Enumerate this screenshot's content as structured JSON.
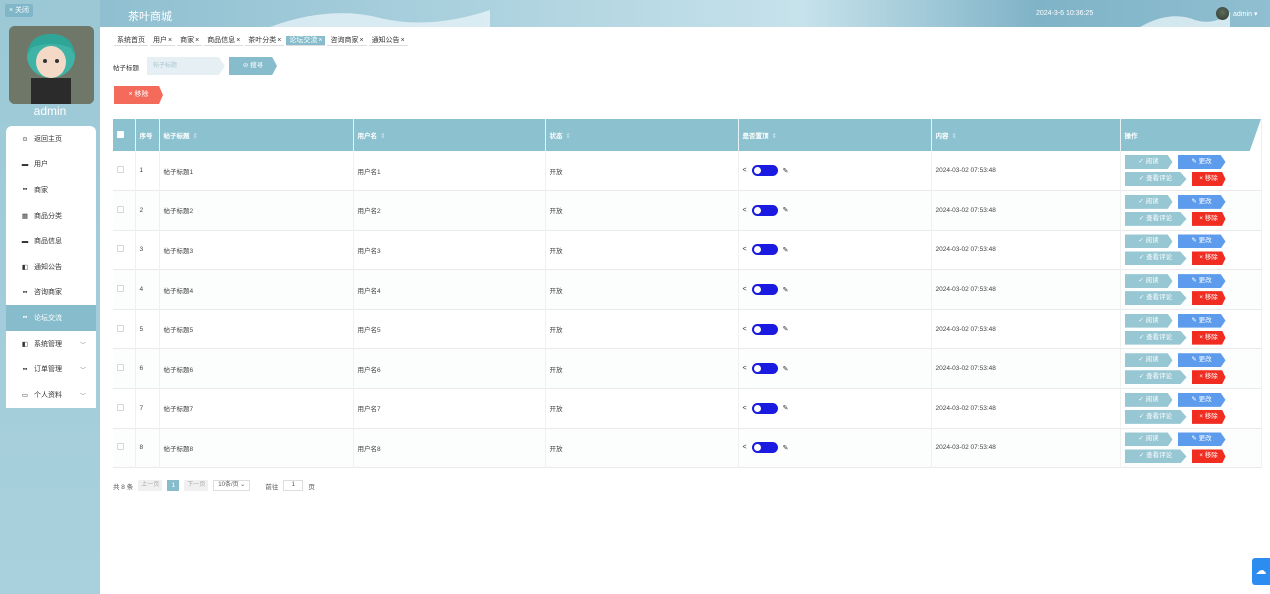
{
  "sidebar": {
    "close_label": "× 关闭",
    "username": "admin",
    "items": [
      {
        "label": "返回主页",
        "icon": "⊙"
      },
      {
        "label": "用户",
        "icon": "▬"
      },
      {
        "label": "商家",
        "icon": "▪▪"
      },
      {
        "label": "商品分类",
        "icon": "▦"
      },
      {
        "label": "商品信息",
        "icon": "▬"
      },
      {
        "label": "通知公告",
        "icon": "◧"
      },
      {
        "label": "咨询商家",
        "icon": "▪▪"
      },
      {
        "label": "论坛交流",
        "icon": "▪▪"
      },
      {
        "label": "系统管理",
        "icon": "◧",
        "arrow": "﹀"
      },
      {
        "label": "订单管理",
        "icon": "▪▪",
        "arrow": "﹀"
      },
      {
        "label": "个人资料",
        "icon": "▭",
        "arrow": "﹀"
      }
    ]
  },
  "header": {
    "title": "茶叶商城",
    "datetime": "2024-3-6 10:36:25",
    "user": "admin ▾"
  },
  "tags": [
    {
      "label": "系统首页",
      "close": ""
    },
    {
      "label": "用户",
      "close": "×"
    },
    {
      "label": "商家",
      "close": "×"
    },
    {
      "label": "商品信息",
      "close": "×"
    },
    {
      "label": "茶叶分类",
      "close": "×"
    },
    {
      "label": "论坛交流",
      "close": "×"
    },
    {
      "label": "咨询商家",
      "close": "×"
    },
    {
      "label": "通知公告",
      "close": "×"
    }
  ],
  "search": {
    "label": "帖子标题",
    "placeholder": "帖子标题",
    "button": "⊘ 搜寻"
  },
  "toolbar": {
    "remove": "× 移除"
  },
  "table": {
    "headers": {
      "index": "序号",
      "title": "帖子标题",
      "username": "用户名",
      "status": "状态",
      "pinned": "是否置顶",
      "content": "内容",
      "ops": "操作"
    },
    "sort_icon": "⇕",
    "rows": [
      {
        "index": "1",
        "title": "帖子标题1",
        "username": "用户名1",
        "status": "开放",
        "content": "2024-03-02 07:53:48"
      },
      {
        "index": "2",
        "title": "帖子标题2",
        "username": "用户名2",
        "status": "开放",
        "content": "2024-03-02 07:53:48"
      },
      {
        "index": "3",
        "title": "帖子标题3",
        "username": "用户名3",
        "status": "开放",
        "content": "2024-03-02 07:53:48"
      },
      {
        "index": "4",
        "title": "帖子标题4",
        "username": "用户名4",
        "status": "开放",
        "content": "2024-03-02 07:53:48"
      },
      {
        "index": "5",
        "title": "帖子标题5",
        "username": "用户名5",
        "status": "开放",
        "content": "2024-03-02 07:53:48"
      },
      {
        "index": "6",
        "title": "帖子标题6",
        "username": "用户名6",
        "status": "开放",
        "content": "2024-03-02 07:53:48"
      },
      {
        "index": "7",
        "title": "帖子标题7",
        "username": "用户名7",
        "status": "开放",
        "content": "2024-03-02 07:53:48"
      },
      {
        "index": "8",
        "title": "帖子标题8",
        "username": "用户名8",
        "status": "开放",
        "content": "2024-03-02 07:53:48"
      }
    ],
    "ops": {
      "read": "✓ 阅读",
      "edit": "✎ 更改",
      "comments": "✓ 查看评论",
      "delete": "× 移除"
    }
  },
  "pager": {
    "total": "共 8 条",
    "prev": "上一页",
    "page": "1",
    "next": "下一页",
    "size": "10条/页 ⌄",
    "goto": "前往",
    "goto_value": "1",
    "page_unit": "页"
  },
  "colors": {
    "accent": "#86bccb",
    "danger": "#f02d20",
    "primary": "#5d9cec",
    "switch": "#1a1ae0"
  },
  "float_icon": "cloud-icon"
}
